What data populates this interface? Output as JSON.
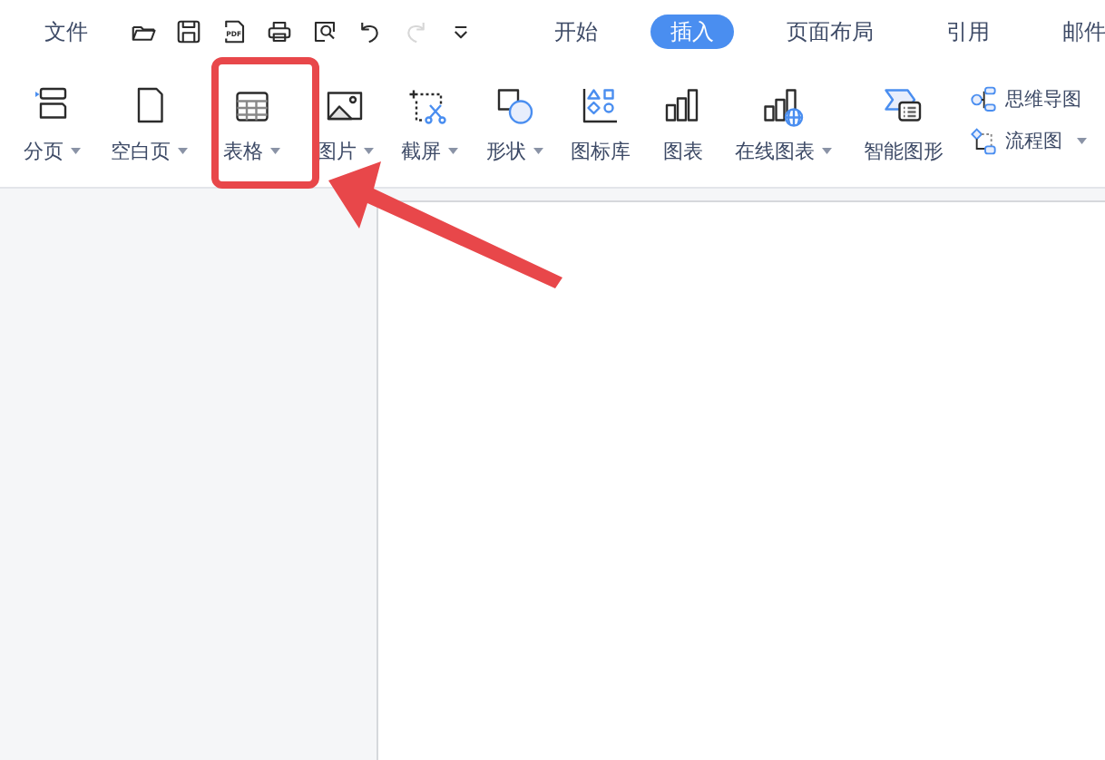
{
  "menu": {
    "label": "文件"
  },
  "quick_tools": [
    {
      "disabled": false
    },
    {
      "disabled": false
    },
    {
      "disabled": false,
      "label": "PDF"
    },
    {
      "disabled": false
    },
    {
      "disabled": false
    },
    {
      "disabled": false
    },
    {
      "disabled": true
    },
    {
      "disabled": false
    }
  ],
  "tabs": [
    {
      "label": "开始",
      "selected": false
    },
    {
      "label": "插入",
      "selected": true
    },
    {
      "label": "页面布局",
      "selected": false
    },
    {
      "label": "引用",
      "selected": false
    },
    {
      "label": "邮件",
      "selected": false
    }
  ],
  "ribbon": [
    {
      "kind": "large",
      "label": "分页",
      "dropdown": true,
      "highlighted": false
    },
    {
      "kind": "large",
      "label": "空白页",
      "dropdown": true,
      "highlighted": false
    },
    {
      "kind": "large",
      "label": "表格",
      "dropdown": true,
      "highlighted": true
    },
    {
      "kind": "large",
      "label": "图片",
      "dropdown": true,
      "highlighted": false
    },
    {
      "kind": "large",
      "label": "截屏",
      "dropdown": true,
      "highlighted": false
    },
    {
      "kind": "large",
      "label": "形状",
      "dropdown": true,
      "highlighted": false
    },
    {
      "kind": "large",
      "label": "图标库",
      "dropdown": false,
      "highlighted": false
    },
    {
      "kind": "large",
      "label": "图表",
      "dropdown": false,
      "highlighted": false
    },
    {
      "kind": "large",
      "label": "在线图表",
      "dropdown": true,
      "highlighted": false
    },
    {
      "kind": "large",
      "label": "智能图形",
      "dropdown": false,
      "highlighted": false
    }
  ],
  "small_tools": [
    {
      "label": "思维导图",
      "dropdown": false
    },
    {
      "label": "流程图",
      "dropdown": true
    }
  ]
}
